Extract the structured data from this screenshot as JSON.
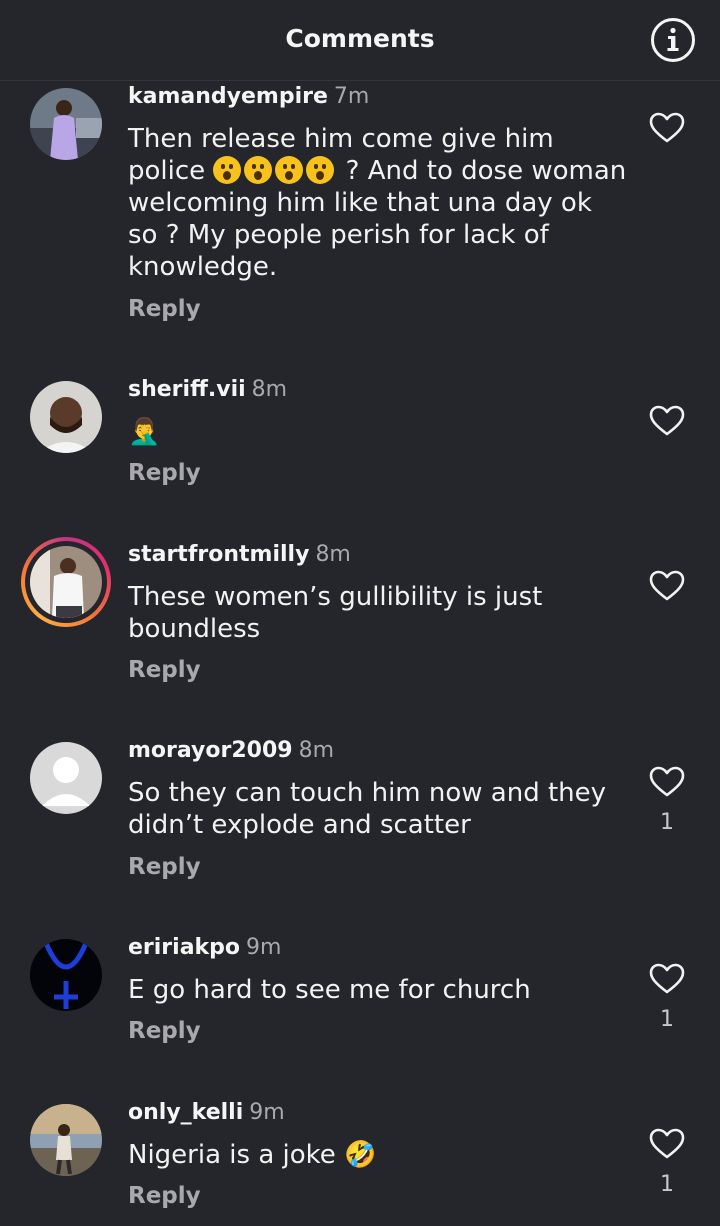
{
  "header": {
    "title": "Comments",
    "info_icon": "info-icon"
  },
  "comments": [
    {
      "username": "kamandyempire",
      "time": "7m",
      "text_before": "Then release him come give him police ",
      "text_after": " ? And to dose woman welcoming him like that una day ok so ?  My people perish for lack of knowledge.",
      "reply": "Reply",
      "likes": ""
    },
    {
      "username": "sheriff.vii",
      "time": "8m",
      "text": "🤦‍♂️",
      "reply": "Reply",
      "likes": ""
    },
    {
      "username": "startfrontmilly",
      "time": "8m",
      "text": "These women’s gullibility is just boundless",
      "reply": "Reply",
      "likes": ""
    },
    {
      "username": "morayor2009",
      "time": "8m",
      "text": "So they can touch him now and they didn’t explode and scatter",
      "reply": "Reply",
      "likes": "1"
    },
    {
      "username": "eririakpo",
      "time": "9m",
      "text": "E go hard to see me for church",
      "reply": "Reply",
      "likes": "1"
    },
    {
      "username": "only_kelli",
      "time": "9m",
      "text": "Nigeria is a joke 🤣",
      "reply": "Reply",
      "likes": "1"
    }
  ]
}
